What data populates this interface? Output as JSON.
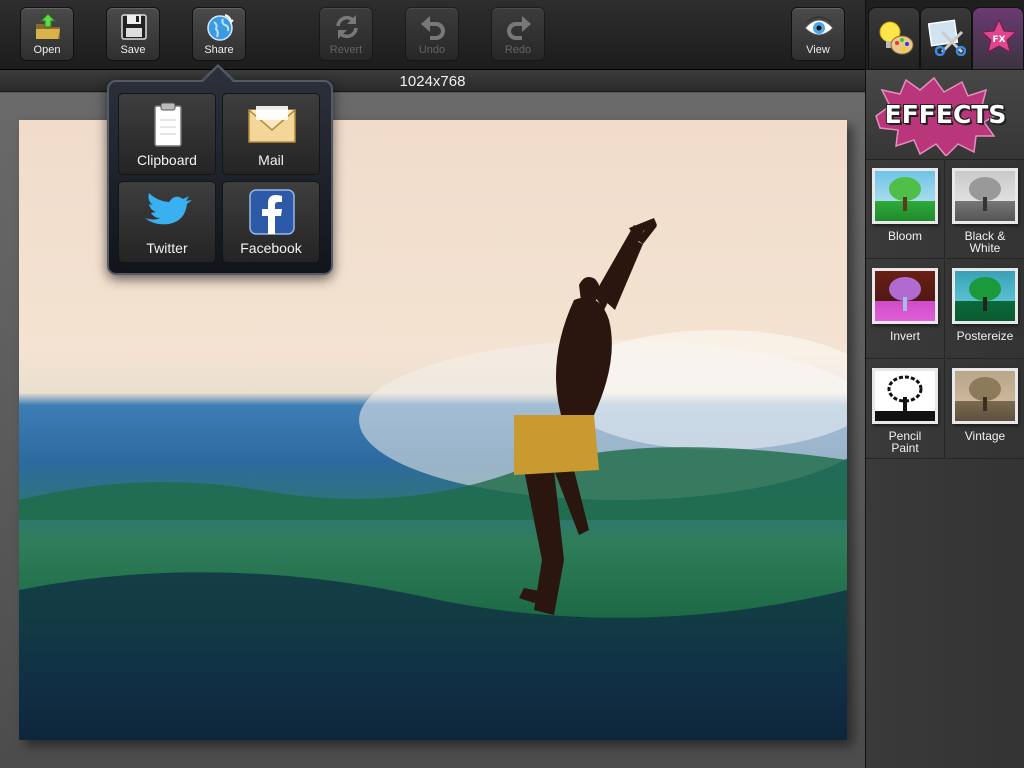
{
  "toolbar": {
    "open": {
      "label": "Open",
      "icon": "folder-open-icon"
    },
    "save": {
      "label": "Save",
      "icon": "floppy-disk-icon"
    },
    "share": {
      "label": "Share",
      "icon": "globe-share-icon"
    },
    "revert": {
      "label": "Revert",
      "icon": "revert-arrows-icon"
    },
    "undo": {
      "label": "Undo",
      "icon": "undo-arrow-icon"
    },
    "redo": {
      "label": "Redo",
      "icon": "redo-arrow-icon"
    },
    "view": {
      "label": "View",
      "icon": "eye-icon"
    }
  },
  "canvas": {
    "dimensions": "1024x768"
  },
  "share_popover": {
    "items": [
      {
        "label": "Clipboard",
        "icon": "clipboard-icon"
      },
      {
        "label": "Mail",
        "icon": "envelope-icon"
      },
      {
        "label": "Twitter",
        "icon": "twitter-bird-icon"
      },
      {
        "label": "Facebook",
        "icon": "facebook-icon"
      }
    ]
  },
  "panel": {
    "tabs": [
      {
        "icon": "lightbulb-palette-icon"
      },
      {
        "icon": "scissors-icon"
      },
      {
        "icon": "fx-star-icon",
        "active": true
      }
    ],
    "effects_title": "EFFECTS",
    "effects": [
      {
        "label": "Bloom"
      },
      {
        "label": "Black & White"
      },
      {
        "label": "Invert"
      },
      {
        "label": "Postereize"
      },
      {
        "label": "Pencil Paint"
      },
      {
        "label": "Vintage"
      }
    ]
  }
}
